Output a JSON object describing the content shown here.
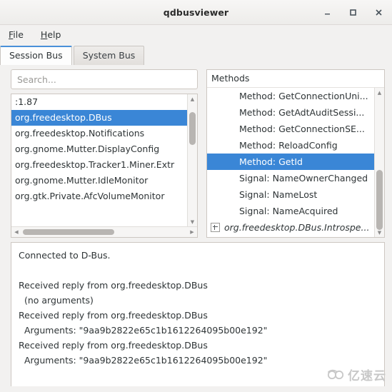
{
  "window": {
    "title": "qdbusviewer",
    "controls": [
      {
        "name": "minimize",
        "glyph": "minimize-icon"
      },
      {
        "name": "maximize",
        "glyph": "maximize-icon"
      },
      {
        "name": "close",
        "glyph": "close-icon"
      }
    ]
  },
  "menubar": {
    "items": [
      {
        "label": "File",
        "accel": "F"
      },
      {
        "label": "Help",
        "accel": "H"
      }
    ]
  },
  "tabs": [
    {
      "label": "Session Bus",
      "active": true
    },
    {
      "label": "System Bus",
      "active": false
    }
  ],
  "search": {
    "placeholder": "Search...",
    "value": ""
  },
  "services": {
    "items": [
      {
        "label": ":1.87",
        "selected": false
      },
      {
        "label": "org.freedesktop.DBus",
        "selected": true
      },
      {
        "label": "org.freedesktop.Notifications",
        "selected": false
      },
      {
        "label": "org.gnome.Mutter.DisplayConfig",
        "selected": false
      },
      {
        "label": "org.freedesktop.Tracker1.Miner.Extr",
        "selected": false
      },
      {
        "label": "org.gnome.Mutter.IdleMonitor",
        "selected": false
      },
      {
        "label": "org.gtk.Private.AfcVolumeMonitor",
        "selected": false
      }
    ]
  },
  "methods": {
    "header": "Methods",
    "items": [
      {
        "label": "Method: GetConnectionUni...",
        "selected": false,
        "kind": "leaf"
      },
      {
        "label": "Method: GetAdtAuditSessi...",
        "selected": false,
        "kind": "leaf"
      },
      {
        "label": "Method: GetConnectionSE...",
        "selected": false,
        "kind": "leaf"
      },
      {
        "label": "Method: ReloadConfig",
        "selected": false,
        "kind": "leaf"
      },
      {
        "label": "Method: GetId",
        "selected": true,
        "kind": "leaf"
      },
      {
        "label": "Signal: NameOwnerChanged",
        "selected": false,
        "kind": "leaf"
      },
      {
        "label": "Signal: NameLost",
        "selected": false,
        "kind": "leaf"
      },
      {
        "label": "Signal: NameAcquired",
        "selected": false,
        "kind": "leaf"
      },
      {
        "label": "org.freedesktop.DBus.Introspe...",
        "selected": false,
        "kind": "node"
      }
    ]
  },
  "log": {
    "lines": [
      "Connected to D-Bus.",
      "",
      "Received reply from org.freedesktop.DBus",
      "  (no arguments)",
      "Received reply from org.freedesktop.DBus",
      "  Arguments: \"9aa9b2822e65c1b1612264095b00e192\"",
      "Received reply from org.freedesktop.DBus",
      "  Arguments: \"9aa9b2822e65c1b1612264095b00e192\""
    ]
  },
  "watermark": {
    "text": "亿速云"
  },
  "colors": {
    "selection": "#3a86d6",
    "tab_accent": "#4a90d9",
    "window_bg": "#f2f1f0",
    "panel_bg": "#ffffff",
    "border": "#cdc7c2",
    "text": "#2e3436",
    "placeholder": "#9a9996"
  }
}
